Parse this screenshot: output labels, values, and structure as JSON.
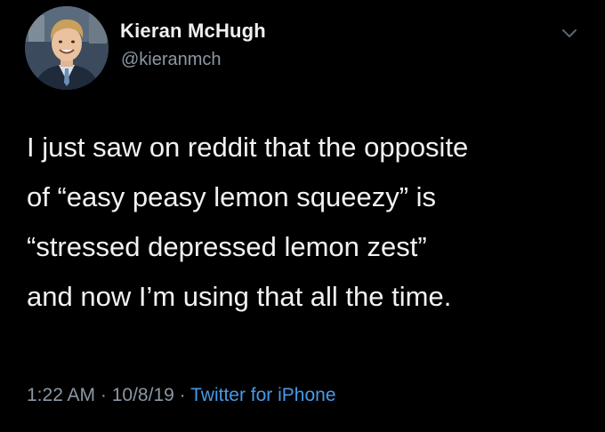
{
  "author": {
    "display_name": "Kieran McHugh",
    "handle": "@kieranmch"
  },
  "tweet": {
    "lines": [
      "I just saw on reddit that the opposite",
      "of “easy peasy lemon squeezy” is",
      "“stressed depressed lemon zest”",
      "and now I’m using that all the time."
    ]
  },
  "meta": {
    "time": "1:22 AM",
    "separator": " · ",
    "date": "10/8/19",
    "source": "Twitter for iPhone"
  },
  "icons": {
    "menu": "chevron-down-icon",
    "avatar": "profile-photo"
  },
  "colors": {
    "background": "#000000",
    "primary_text": "#f2f2f2",
    "secondary_text": "#8b98a5",
    "link": "#4a99e9"
  }
}
